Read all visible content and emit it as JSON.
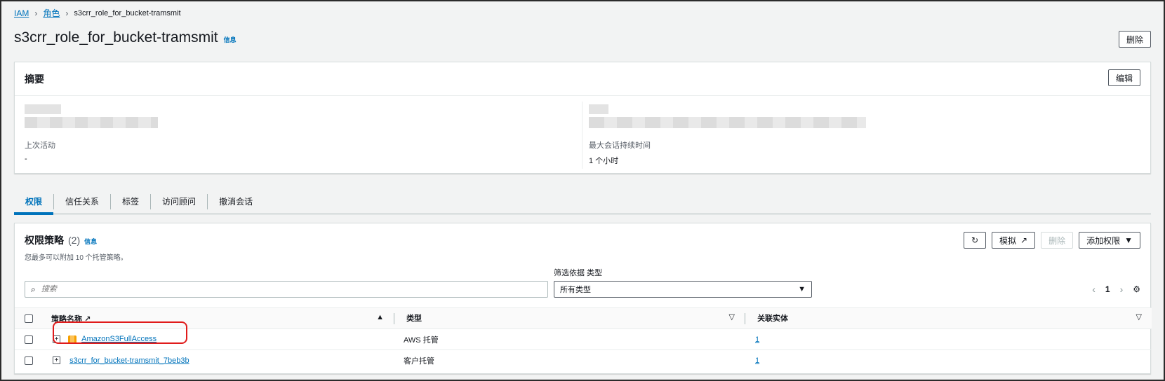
{
  "breadcrumb": {
    "items": [
      "IAM",
      "角色"
    ],
    "current": "s3crr_role_for_bucket-tramsmit"
  },
  "header": {
    "title": "s3crr_role_for_bucket-tramsmit",
    "info_label": "信息",
    "delete_label": "删除"
  },
  "summary": {
    "title": "摘要",
    "edit_label": "编辑",
    "last_activity_label": "上次活动",
    "last_activity_value": "-",
    "max_session_label": "最大会话持续时间",
    "max_session_value": "1 个小时"
  },
  "tabs": [
    {
      "label": "权限",
      "active": true
    },
    {
      "label": "信任关系",
      "active": false
    },
    {
      "label": "标签",
      "active": false
    },
    {
      "label": "访问顾问",
      "active": false
    },
    {
      "label": "撤消会话",
      "active": false
    }
  ],
  "policies": {
    "title": "权限策略",
    "count": "(2)",
    "info_label": "信息",
    "description": "您最多可以附加 10 个托管策略。",
    "simulate_label": "模拟",
    "delete_label": "删除",
    "add_permissions_label": "添加权限",
    "filter_label": "筛选依据 类型",
    "search_placeholder": "搜索",
    "type_select_value": "所有类型",
    "current_page": "1",
    "columns": {
      "name": "策略名称",
      "type": "类型",
      "entities": "关联实体"
    },
    "rows": [
      {
        "name": "AmazonS3FullAccess",
        "type": "AWS 托管",
        "entities": "1"
      },
      {
        "name": "s3crr_for_bucket-tramsmit_7beb3b",
        "type": "客户托管",
        "entities": "1"
      }
    ]
  },
  "colors": {
    "link": "#0073bb",
    "highlight": "#e01b1b",
    "aws_icon": "#f59f00"
  }
}
